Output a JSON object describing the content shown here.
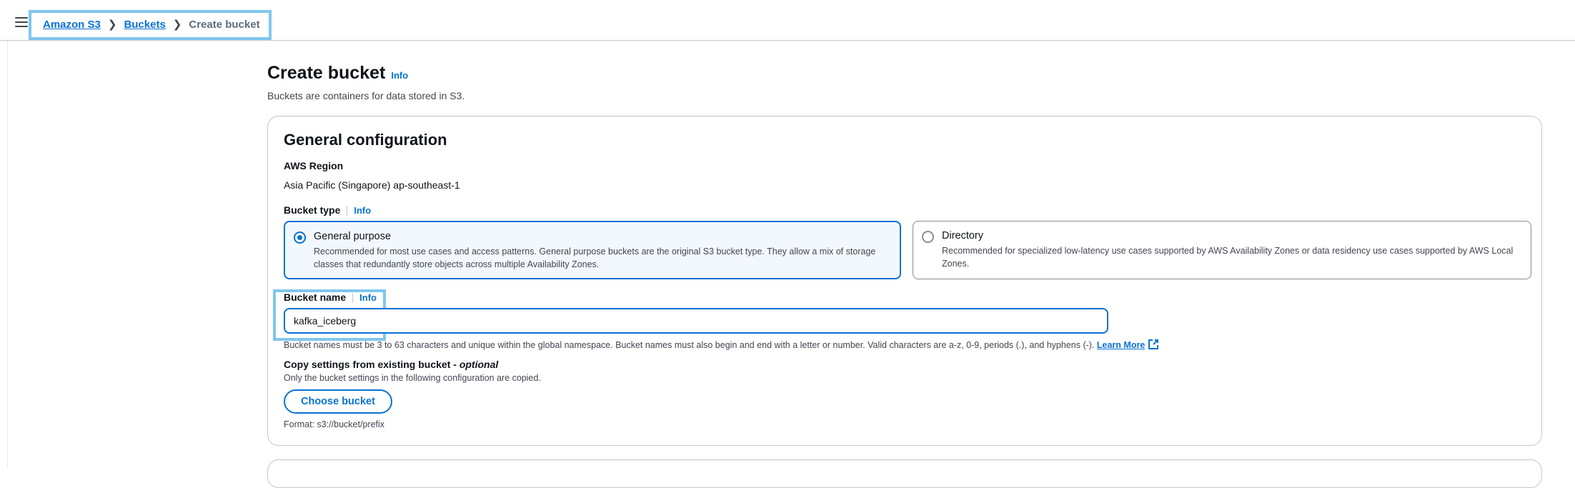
{
  "breadcrumb": {
    "items": [
      "Amazon S3",
      "Buckets"
    ],
    "current": "Create bucket"
  },
  "page": {
    "title": "Create bucket",
    "info": "Info",
    "description": "Buckets are containers for data stored in S3."
  },
  "general": {
    "title": "General configuration",
    "region_label": "AWS Region",
    "region_value": "Asia Pacific (Singapore) ap-southeast-1",
    "bucket_type_label": "Bucket type",
    "bucket_type_info": "Info",
    "types": [
      {
        "title": "General purpose",
        "desc": "Recommended for most use cases and access patterns. General purpose buckets are the original S3 bucket type. They allow a mix of storage classes that redundantly store objects across multiple Availability Zones.",
        "selected": true
      },
      {
        "title": "Directory",
        "desc": "Recommended for specialized low-latency use cases supported by AWS Availability Zones or data residency use cases supported by AWS Local Zones.",
        "selected": false
      }
    ],
    "bucket_name_label": "Bucket name",
    "bucket_name_info": "Info",
    "bucket_name_value": "kafka_iceberg",
    "bucket_name_hint": "Bucket names must be 3 to 63 characters and unique within the global namespace. Bucket names must also begin and end with a letter or number. Valid characters are a-z, 0-9, periods (.), and hyphens (-).",
    "learn_more": "Learn More",
    "copy_title": "Copy settings from existing bucket - ",
    "copy_optional": "optional",
    "copy_desc": "Only the bucket settings in the following configuration are copied.",
    "choose_button": "Choose bucket",
    "format_hint": "Format: s3://bucket/prefix"
  },
  "colors": {
    "accent": "#0972d3",
    "highlight": "#7fc7ee"
  }
}
